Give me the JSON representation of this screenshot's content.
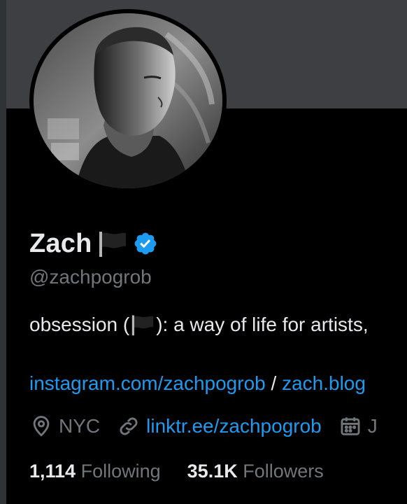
{
  "profile": {
    "name": "Zach",
    "handle": "@zachpogrob",
    "bio_prefix": "obsession (",
    "bio_suffix": "): a way of life for artists,",
    "link_primary": "instagram.com/zachpogrob",
    "link_separator": " / ",
    "link_secondary": "zach.blog",
    "location": "NYC",
    "website": "linktr.ee/zachpogrob",
    "joined_partial": "J",
    "following_count": "1,114",
    "following_label": "Following",
    "followers_count": "35.1K",
    "followers_label": "Followers"
  },
  "icons": {
    "flag": "black-flag-icon",
    "verified": "verified-badge-icon",
    "location": "location-pin-icon",
    "link": "link-icon",
    "calendar": "calendar-icon"
  },
  "colors": {
    "background": "#000000",
    "banner": "#3e3f43",
    "accent": "#1d9bf0",
    "muted": "#71767b",
    "text": "#e7e9ea"
  }
}
